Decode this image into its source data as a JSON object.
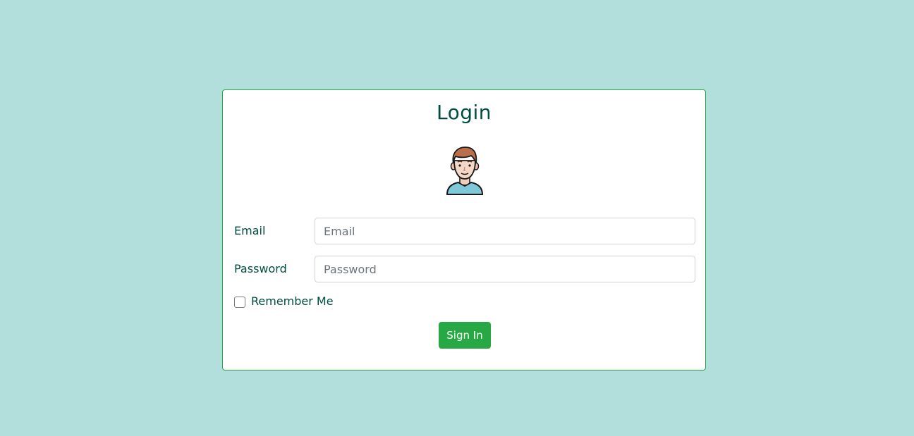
{
  "login": {
    "title": "Login",
    "avatar_icon": "user-avatar-icon",
    "email_label": "Email",
    "email_placeholder": "Email",
    "email_value": "",
    "password_label": "Password",
    "password_placeholder": "Password",
    "password_value": "",
    "remember_label": "Remember Me",
    "remember_checked": false,
    "signin_label": "Sign In"
  },
  "colors": {
    "background": "#b2dfdb",
    "card_border": "#28a745",
    "text": "#004d40",
    "button": "#28a745",
    "button_text": "#ffffff"
  }
}
